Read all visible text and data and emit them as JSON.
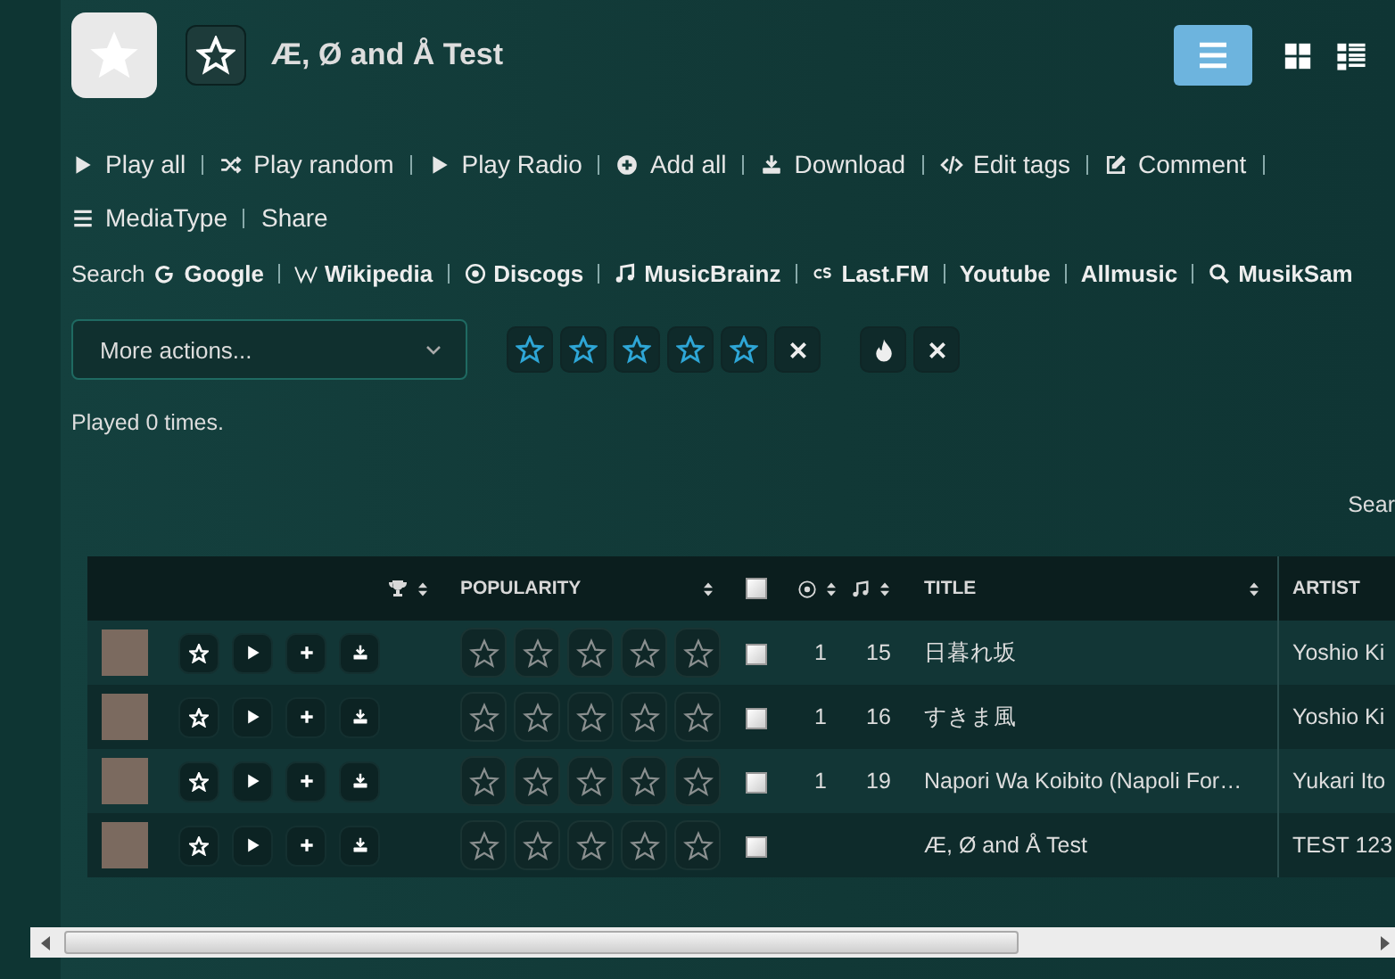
{
  "header": {
    "title": "Æ, Ø and Å Test",
    "favorite": false,
    "views": [
      {
        "kind": "list",
        "selected": true
      },
      {
        "kind": "grid",
        "selected": false
      },
      {
        "kind": "details",
        "selected": false
      }
    ]
  },
  "action_rows": [
    {
      "items": [
        {
          "kind": "play",
          "label": "Play all"
        },
        {
          "kind": "shuffle",
          "label": "Play random"
        },
        {
          "kind": "play",
          "label": "Play Radio"
        },
        {
          "kind": "add",
          "label": "Add all"
        },
        {
          "kind": "download",
          "label": "Download"
        },
        {
          "kind": "code",
          "label": "Edit tags"
        },
        {
          "kind": "edit",
          "label": "Comment"
        }
      ]
    },
    {
      "items": [
        {
          "kind": "list",
          "label": "MediaType"
        },
        {
          "kind": "none",
          "label": "Share"
        }
      ]
    }
  ],
  "search_links": {
    "label": "Search",
    "links": [
      {
        "kind": "google",
        "label": "Google"
      },
      {
        "kind": "wikipedia",
        "label": "Wikipedia"
      },
      {
        "kind": "record",
        "label": "Discogs"
      },
      {
        "kind": "note",
        "label": "MusicBrainz"
      },
      {
        "kind": "lastfm",
        "label": "Last.FM"
      },
      {
        "kind": "none",
        "label": "Youtube"
      },
      {
        "kind": "none",
        "label": "Allmusic"
      },
      {
        "kind": "search",
        "label": "MusikSam"
      }
    ]
  },
  "more_actions": {
    "value": "More actions..."
  },
  "rating": {
    "stars": 0
  },
  "play_count": "Played 0 times.",
  "search_label": "Sear",
  "table": {
    "columns": [
      {
        "kind": "trophy"
      },
      {
        "kind": "text",
        "label": "POPULARITY"
      },
      {
        "kind": "checkbox",
        "checked": false
      },
      {
        "kind": "disc"
      },
      {
        "kind": "track"
      },
      {
        "kind": "text",
        "label": "TITLE"
      },
      {
        "kind": "text",
        "label": "ARTIST"
      }
    ],
    "rows": [
      {
        "disc": "1",
        "track": "15",
        "title": "日暮れ坂",
        "artist": "Yoshio Ki",
        "stars": 0,
        "checked": false
      },
      {
        "disc": "1",
        "track": "16",
        "title": "すきま風",
        "artist": "Yoshio Ki",
        "stars": 0,
        "checked": false
      },
      {
        "disc": "1",
        "track": "19",
        "title": "Napori Wa Koibito (Napoli For…",
        "artist": "Yukari Ito",
        "stars": 0,
        "checked": false
      },
      {
        "title": "Æ, Ø and Å Test",
        "artist": "TEST 123",
        "stars": 0,
        "checked": false
      }
    ]
  }
}
